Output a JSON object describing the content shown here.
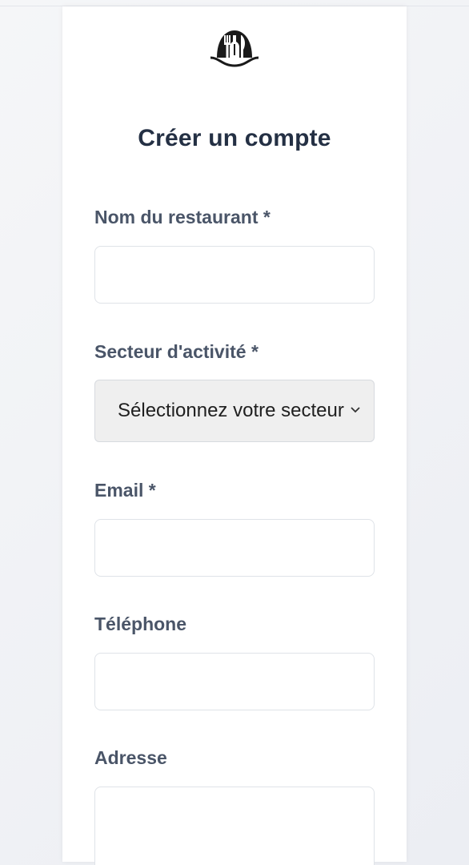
{
  "form": {
    "title": "Créer un compte",
    "fields": {
      "restaurant_name": {
        "label": "Nom du restaurant *",
        "value": ""
      },
      "sector": {
        "label": "Secteur d'activité *",
        "selected": "Sélectionnez votre secteur"
      },
      "email": {
        "label": "Email *",
        "value": ""
      },
      "phone": {
        "label": "Téléphone",
        "value": ""
      },
      "address": {
        "label": "Adresse",
        "value": ""
      }
    }
  },
  "icons": {
    "logo": "restaurant-logo-icon",
    "select_arrow": "chevron-down-icon"
  },
  "colors": {
    "title": "#243044",
    "label": "#4a5568",
    "field_border": "#dfe3e8",
    "select_bg": "#efefef"
  }
}
